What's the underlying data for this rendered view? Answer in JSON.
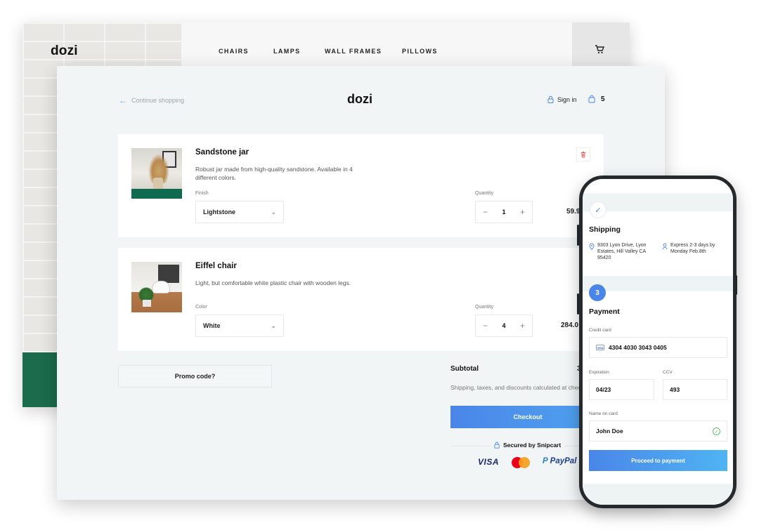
{
  "back_window": {
    "logo": "dozi",
    "nav": [
      "CHAIRS",
      "LAMPS",
      "WALL FRAMES",
      "PILLOWS"
    ]
  },
  "cart": {
    "continue_label": "Continue shopping",
    "logo": "dozi",
    "sign_in": "Sign in",
    "bag_count": "5",
    "items": [
      {
        "name": "Sandstone jar",
        "description": "Robust jar made from high-quality sandstone. Available in 4 different colors.",
        "option_label": "Finish",
        "option_value": "Lightstone",
        "quantity_label": "Quantity",
        "quantity": "1",
        "price": "59.9"
      },
      {
        "name": "Eiffel chair",
        "description": "Light, but comfortable white plastic chair with wooden legs.",
        "option_label": "Color",
        "option_value": "White",
        "quantity_label": "Quantity",
        "quantity": "4",
        "price": "284.0"
      }
    ],
    "promo": "Promo code?",
    "subtotal_label": "Subtotal",
    "subtotal_value": "3",
    "shipping_note": "Shipping, taxes, and discounts calculated at check",
    "checkout": "Checkout",
    "secured": "Secured by Snipcart",
    "payment_logos": [
      "VISA",
      "PayPal"
    ]
  },
  "phone": {
    "shipping_title": "Shipping",
    "address": "9303 Lyon Drive, Lyon Estates, Hill Valley CA 95420",
    "express": "Express 2-3 days by Monday Feb.8th",
    "step_number": "3",
    "payment_title": "Payment",
    "credit_card_label": "Credit card",
    "card_number": "4304 4030 3043 0405",
    "expiration_label": "Expiration",
    "expiration": "04/23",
    "ccv_label": "CCV",
    "ccv": "493",
    "name_label": "Name on card",
    "name": "John Doe",
    "proceed": "Proceed to payment"
  },
  "colors": {
    "accent_blue": "#4a86e8",
    "panel_bg": "#f1f5f5",
    "plant_green": "#0f6b50"
  }
}
